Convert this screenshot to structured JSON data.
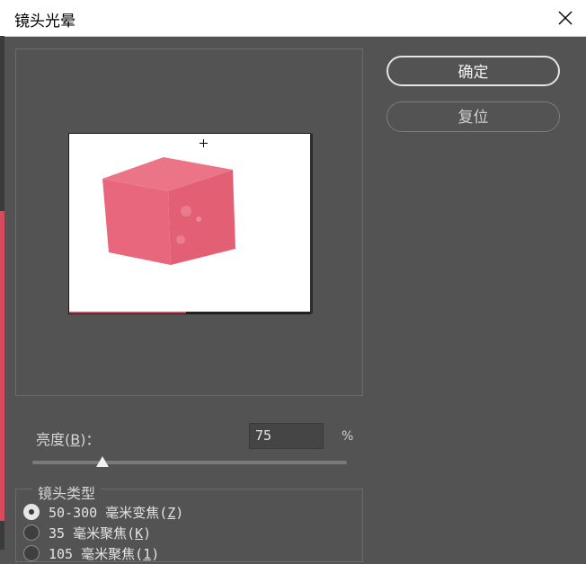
{
  "window": {
    "title": "镜头光晕"
  },
  "buttons": {
    "ok": "确定",
    "reset": "复位"
  },
  "brightness": {
    "label_prefix": "亮度(",
    "label_key": "B",
    "label_suffix": ")：",
    "value": "75",
    "unit": "%",
    "slider_value_percent": 75
  },
  "lens_type": {
    "title": "镜头类型",
    "options": [
      {
        "prefix": "50-300 毫米变焦(",
        "key": "Z",
        "suffix": ")",
        "checked": true
      },
      {
        "prefix": "35 毫米聚焦(",
        "key": "K",
        "suffix": ")",
        "checked": false
      },
      {
        "prefix": "105 毫米聚焦(",
        "key": "1",
        "suffix": ")",
        "checked": false
      }
    ]
  },
  "colors": {
    "cube": "#e8677c",
    "dialog_bg": "#535353",
    "accent_pink": "#d8495f"
  }
}
